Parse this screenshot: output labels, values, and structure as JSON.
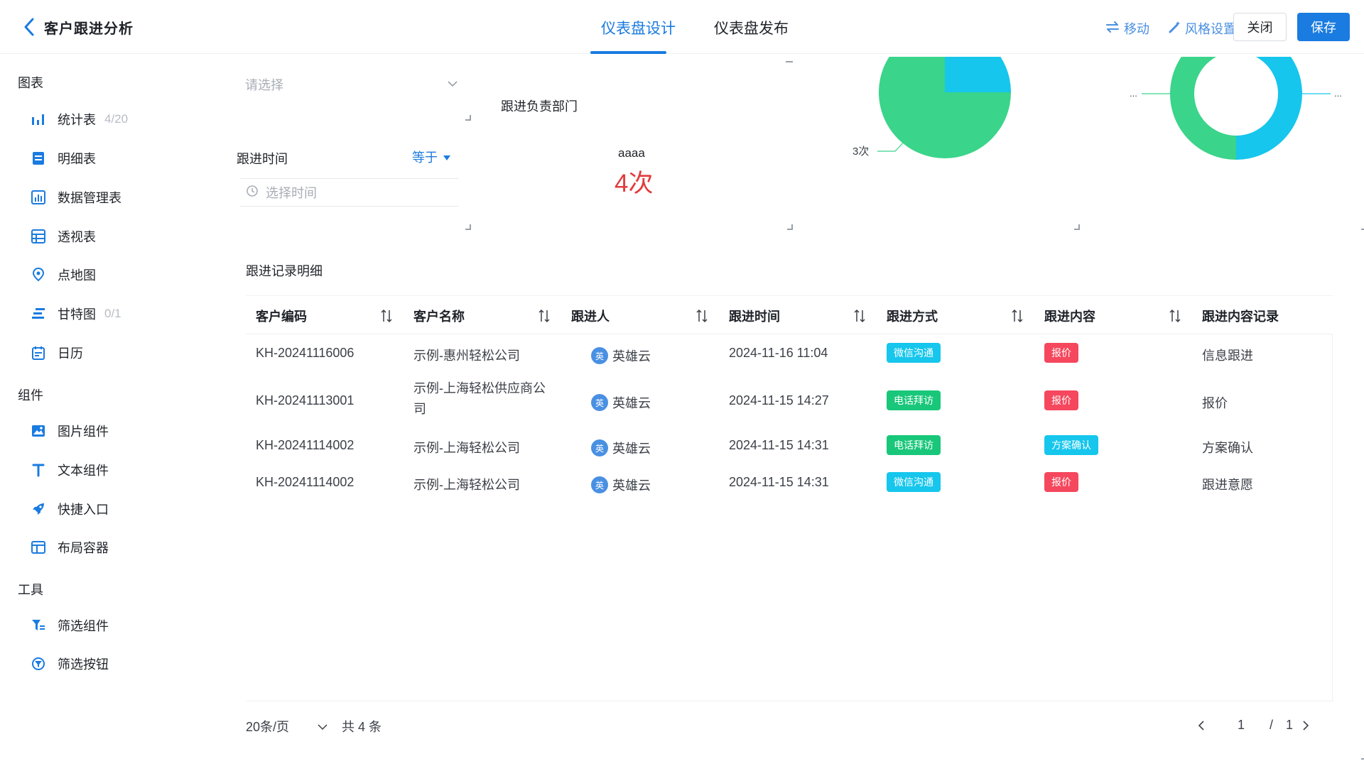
{
  "header": {
    "title": "客户跟进分析",
    "tabs": [
      {
        "label": "仪表盘设计",
        "active": true
      },
      {
        "label": "仪表盘发布",
        "active": false
      }
    ],
    "move_label": "移动",
    "style_label": "风格设置",
    "close_label": "关闭",
    "save_label": "保存",
    "accent_color": "#1a7be0"
  },
  "sidebar": {
    "sections": [
      {
        "title": "图表",
        "items": [
          {
            "label": "统计表",
            "count": "4/20",
            "icon": "bar-chart-icon"
          },
          {
            "label": "明细表",
            "count": "",
            "icon": "detail-table-icon"
          },
          {
            "label": "数据管理表",
            "count": "",
            "icon": "data-management-icon"
          },
          {
            "label": "透视表",
            "count": "",
            "icon": "pivot-table-icon"
          },
          {
            "label": "点地图",
            "count": "",
            "icon": "map-pin-icon"
          },
          {
            "label": "甘特图",
            "count": "0/1",
            "icon": "gantt-icon"
          },
          {
            "label": "日历",
            "count": "",
            "icon": "calendar-icon"
          }
        ]
      },
      {
        "title": "组件",
        "items": [
          {
            "label": "图片组件",
            "icon": "image-icon"
          },
          {
            "label": "文本组件",
            "icon": "text-icon"
          },
          {
            "label": "快捷入口",
            "icon": "rocket-icon"
          },
          {
            "label": "布局容器",
            "icon": "layout-icon"
          }
        ]
      },
      {
        "title": "工具",
        "items": [
          {
            "label": "筛选组件",
            "icon": "filter-icon"
          },
          {
            "label": "筛选按钮",
            "icon": "filter-button-icon"
          }
        ]
      }
    ]
  },
  "filters": {
    "select_placeholder": "请选择",
    "time_label": "跟进时间",
    "time_operator": "等于",
    "time_placeholder": "选择时间"
  },
  "widgets": {
    "dept_label": "跟进负责部门",
    "stat_name": "aaaa",
    "stat_value": "4次",
    "pie_label": "3次",
    "donut_left_label": "...",
    "donut_right_label": "...",
    "pie_colors": [
      "#3ad48a",
      "#16c6ec"
    ],
    "pie_share": [
      0.75,
      0.25
    ],
    "donut_share": [
      0.5,
      0.5
    ]
  },
  "table": {
    "title": "跟进记录明细",
    "columns": [
      "客户编码",
      "客户名称",
      "跟进人",
      "跟进时间",
      "跟进方式",
      "跟进内容",
      "跟进内容记录"
    ],
    "rows": [
      {
        "code": "KH-20241116006",
        "name": "示例-惠州轻松公司",
        "name2": "",
        "person": "英雄云",
        "avatar": "英",
        "time": "2024-11-16 11:04",
        "method": "微信沟通",
        "method_color": "#16c6ec",
        "content": "报价",
        "content_color": "#f5475d",
        "record": "信息跟进"
      },
      {
        "code": "KH-20241113001",
        "name": "示例-上海轻松供应商公",
        "name2": "司",
        "person": "英雄云",
        "avatar": "英",
        "time": "2024-11-15 14:27",
        "method": "电话拜访",
        "method_color": "#19c77a",
        "content": "报价",
        "content_color": "#f5475d",
        "record": "报价"
      },
      {
        "code": "KH-20241114002",
        "name": "示例-上海轻松公司",
        "name2": "",
        "person": "英雄云",
        "avatar": "英",
        "time": "2024-11-15 14:31",
        "method": "电话拜访",
        "method_color": "#19c77a",
        "content": "方案确认",
        "content_color": "#16c6ec",
        "record": "方案确认"
      },
      {
        "code": "KH-20241114002",
        "name": "示例-上海轻松公司",
        "name2": "",
        "person": "英雄云",
        "avatar": "英",
        "time": "2024-11-15 14:31",
        "method": "微信沟通",
        "method_color": "#16c6ec",
        "content": "报价",
        "content_color": "#f5475d",
        "record": "跟进意愿"
      }
    ]
  },
  "pagination": {
    "page_size": "20条/页",
    "total": "共 4 条",
    "current": "1",
    "sep": "/",
    "pages": "1"
  }
}
